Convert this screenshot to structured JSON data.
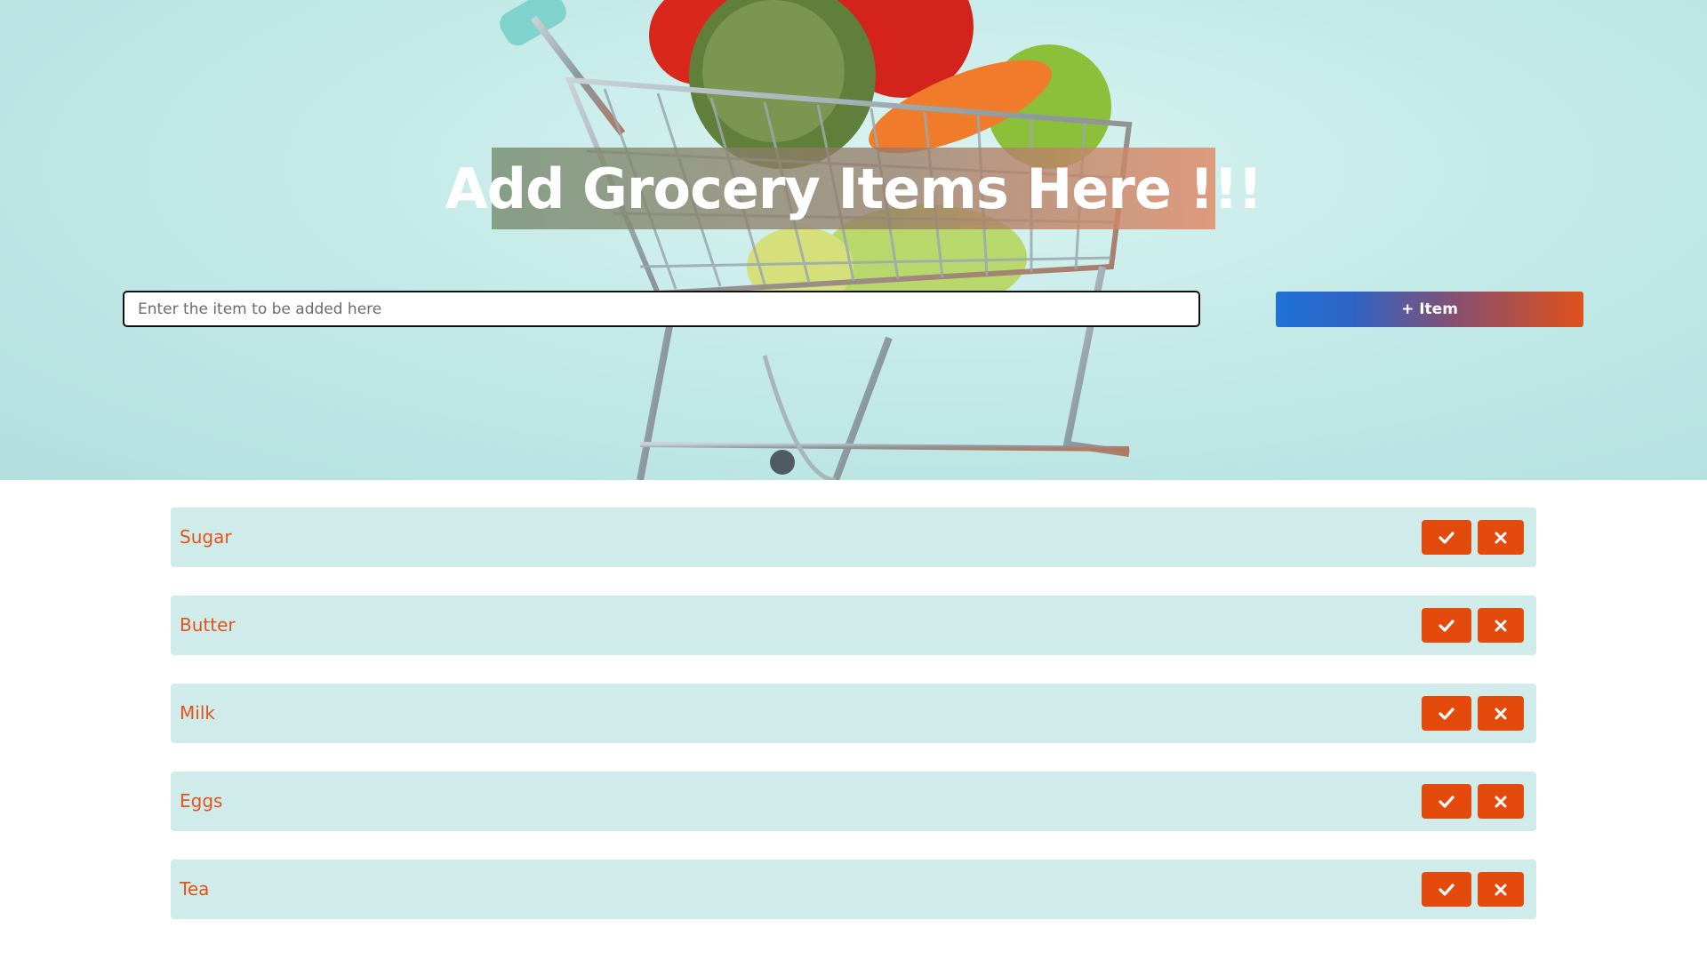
{
  "header": {
    "title": "Add Grocery Items Here !!!"
  },
  "form": {
    "input_placeholder": "Enter the item to be added here",
    "input_value": "",
    "add_button_label": "+ Item"
  },
  "items": [
    {
      "label": "Sugar"
    },
    {
      "label": "Butter"
    },
    {
      "label": "Milk"
    },
    {
      "label": "Eggs"
    },
    {
      "label": "Tea"
    }
  ],
  "icons": {
    "complete": "check-icon",
    "delete": "close-icon"
  },
  "colors": {
    "accent": "#e34a0c",
    "row_background": "#d0ecea",
    "item_text": "#e0541c",
    "button_gradient_start": "#1f72d8",
    "button_gradient_end": "#e0501a"
  }
}
